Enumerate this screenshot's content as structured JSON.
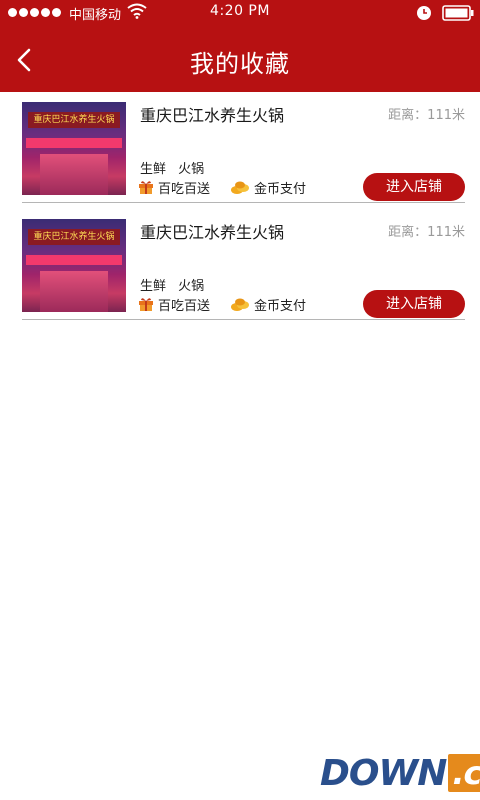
{
  "status_bar": {
    "carrier": "中国移动",
    "time": "4:20 PM",
    "icons": [
      "signal-dots",
      "wifi-icon",
      "alarm-icon",
      "battery-icon"
    ]
  },
  "header": {
    "title": "我的收藏",
    "back_icon": "chevron-left-icon"
  },
  "favorites": [
    {
      "name": "重庆巴江水养生火锅",
      "distance": "距离：111米",
      "tags": [
        "生鲜",
        "火锅"
      ],
      "features": [
        {
          "icon": "gift-icon",
          "label": "百吃百送"
        },
        {
          "icon": "coins-icon",
          "label": "金币支付"
        }
      ],
      "button": "进入店铺",
      "image_sign": "重庆巴江水养生火锅"
    },
    {
      "name": "重庆巴江水养生火锅",
      "distance": "距离：111米",
      "tags": [
        "生鲜",
        "火锅"
      ],
      "features": [
        {
          "icon": "gift-icon",
          "label": "百吃百送"
        },
        {
          "icon": "coins-icon",
          "label": "金币支付"
        }
      ],
      "button": "进入店铺",
      "image_sign": "重庆巴江水养生火锅"
    }
  ],
  "watermark": {
    "text": "DOWN",
    "suffix": ".cc"
  },
  "colors": {
    "brand_red": "#b71112",
    "divider": "#b5b5b5",
    "muted_text": "#9a9a9a"
  }
}
